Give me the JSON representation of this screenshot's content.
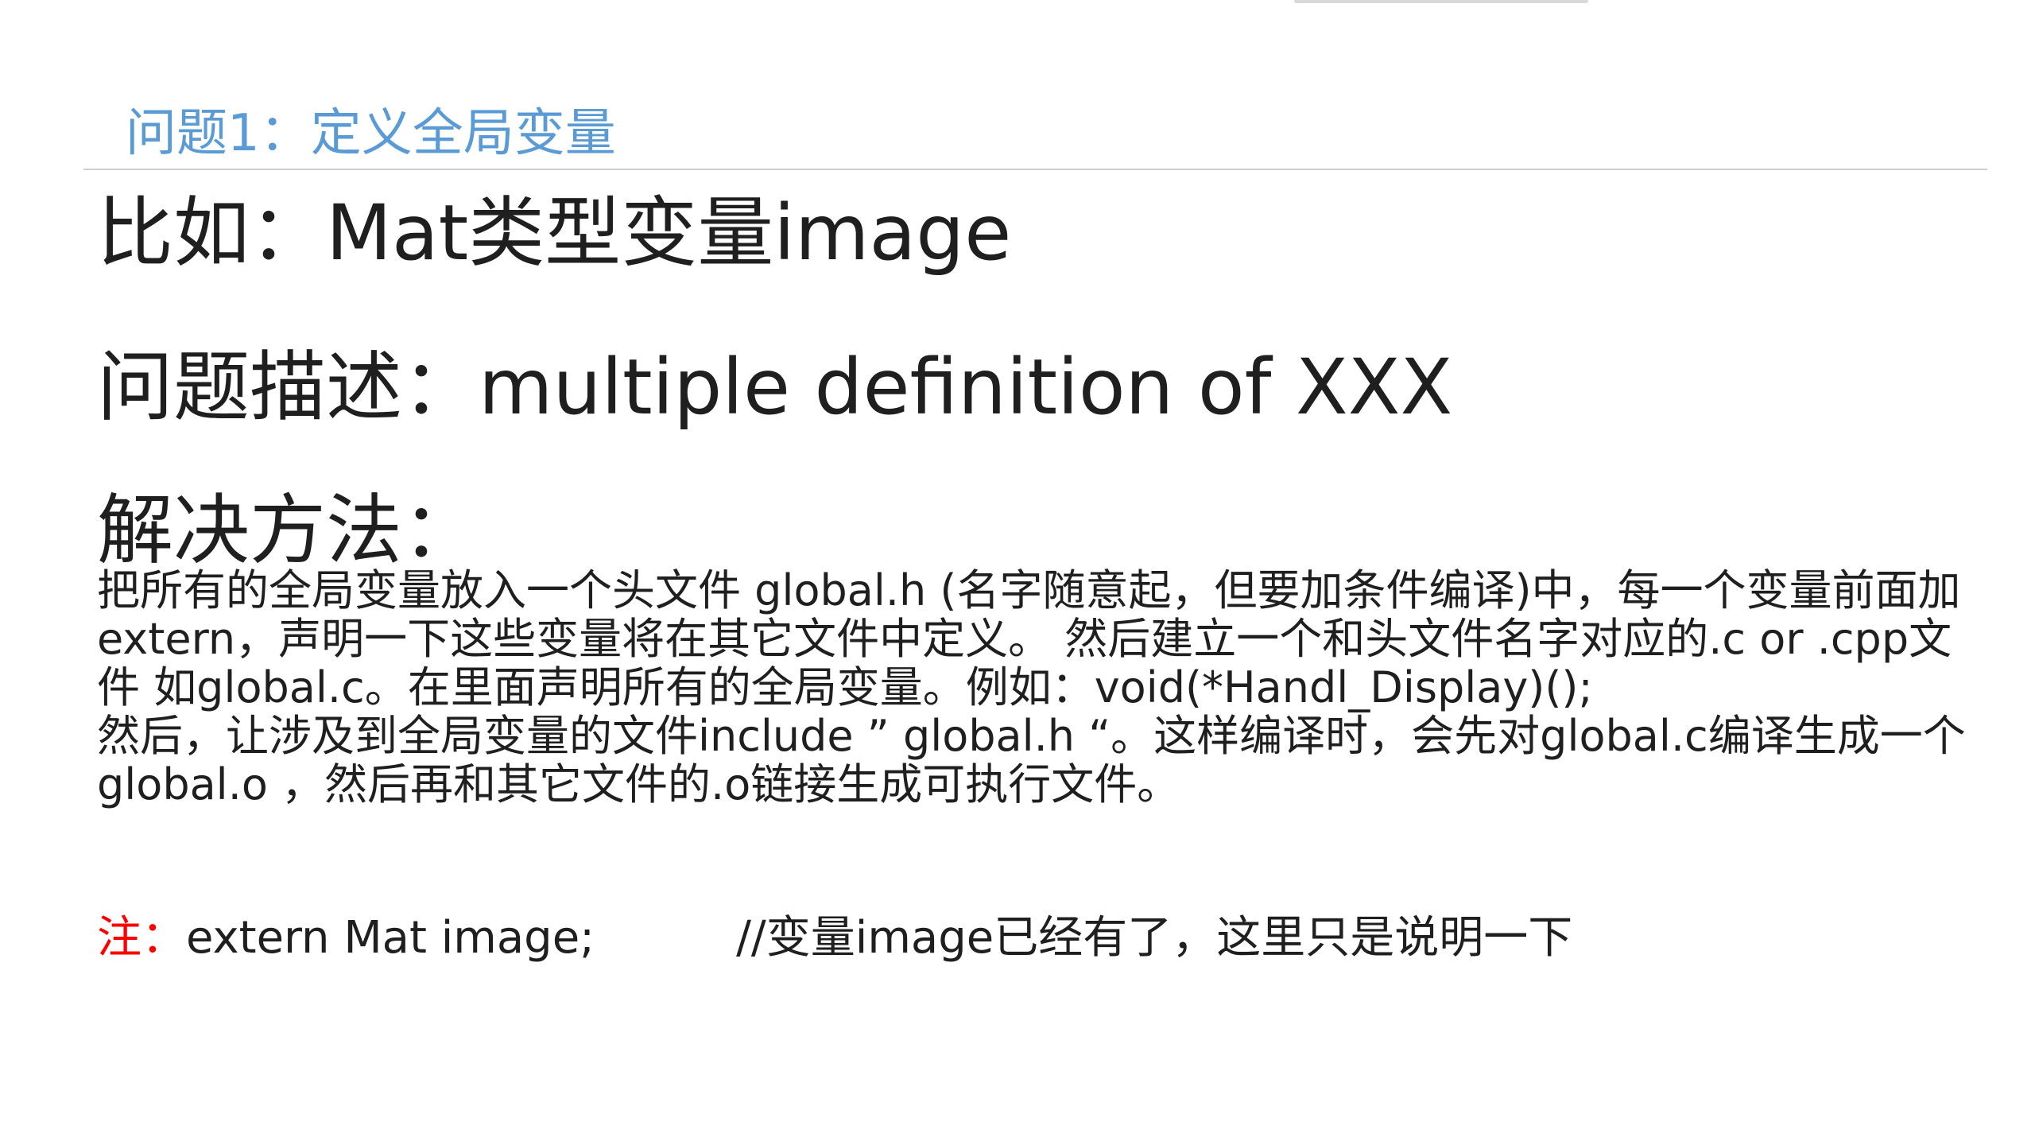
{
  "slide": {
    "title": "问题1：定义全局变量",
    "example_heading": "比如：Mat类型变量image",
    "problem_heading": "问题描述：multiple definition of XXX",
    "solution_heading": "解决方法：",
    "solution_paragraphs": [
      "把所有的全局变量放入一个头文件 global.h (名字随意起，但要加条件编译)中，每一个变量前面加extern，声明一下这些变量将在其它文件中定义。 然后建立一个和头文件名字对应的.c or .cpp文件 如global.c。在里面声明所有的全局变量。例如：void(*Handl_Display)();",
      "然后，让涉及到全局变量的文件include ” global.h “。这样编译时，会先对global.c编译生成一个global.o ，然后再和其它文件的.o链接生成可执行文件。"
    ],
    "note_label": "注：",
    "note_code": "extern Mat image;",
    "note_comment": "//变量image已经有了，这里只是说明一下"
  },
  "colors": {
    "title": "#5b9bd5",
    "body": "#1f1f1f",
    "note_label": "#ff0000",
    "rule": "#cfcfcf"
  }
}
